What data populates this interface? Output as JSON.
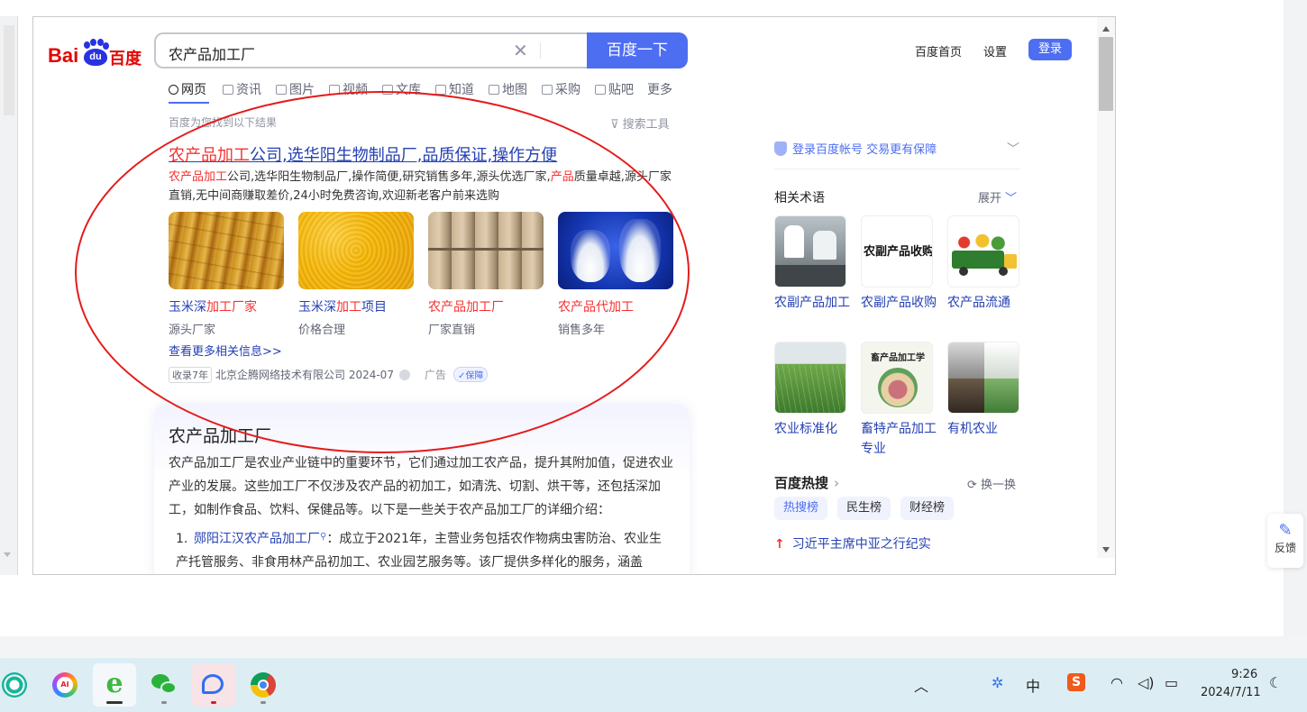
{
  "search": {
    "query": "农产品加工厂",
    "button_label": "百度一下"
  },
  "logo": {
    "bai": "Bai",
    "du": "du",
    "baidu_cn": "百度"
  },
  "header": {
    "home_link": "百度首页",
    "settings_link": "设置",
    "login_button": "登录"
  },
  "tabs": [
    {
      "label": "网页",
      "icon": "search-icon"
    },
    {
      "label": "资讯",
      "icon": "news-icon"
    },
    {
      "label": "图片",
      "icon": "image-icon"
    },
    {
      "label": "视频",
      "icon": "video-icon"
    },
    {
      "label": "文库",
      "icon": "doc-icon"
    },
    {
      "label": "知道",
      "icon": "question-icon"
    },
    {
      "label": "地图",
      "icon": "map-icon"
    },
    {
      "label": "采购",
      "icon": "purchase-icon"
    },
    {
      "label": "贴吧",
      "icon": "tieba-icon"
    },
    {
      "label": "更多",
      "icon": ""
    }
  ],
  "results_header": {
    "found_text": "百度为您找到以下结果",
    "tools_text": "搜索工具"
  },
  "ad_result": {
    "title_hl": "农产品加工",
    "title_rest": "公司,选华阳生物制品厂,品质保证,操作方便",
    "desc_1_hl": "农产品加工",
    "desc_1_mid": "公司,选华阳生物制品厂,操作简便,研究销售多年,源头优选厂家,",
    "desc_1_hl2": "产品",
    "desc_1_end": "质量卓越,源头厂家",
    "desc_2": "直销,无中间商赚取差价,24小时免费咨询,欢迎新老客户前来选购",
    "images": [
      {
        "label_a": "玉米深",
        "label_hl": "加工厂家",
        "label_c": "",
        "sub": "源头厂家"
      },
      {
        "label_a": "玉米深",
        "label_hl": "加工",
        "label_c": "项目",
        "sub": "价格合理"
      },
      {
        "label_a": "",
        "label_hl": "农产品加工厂",
        "label_c": "",
        "sub": "厂家直销"
      },
      {
        "label_a": "",
        "label_hl": "农产品代加工",
        "label_c": "",
        "sub": "销售多年"
      }
    ],
    "more_link": "查看更多相关信息>>",
    "badge": "收录7年",
    "company": "北京企腾网络技术有限公司 2024-07",
    "ad_label": "广告",
    "guarantee": "保障"
  },
  "ai_card": {
    "title": "农产品加工厂",
    "body": "农产品加工厂是农业产业链中的重要环节，它们通过加工农产品，提升其附加值，促进农业产业的发展。这些加工厂不仅涉及农产品的初加工，如清洗、切割、烘干等，还包括深加工，如制作食品、饮料、保健品等。以下是一些关于农产品加工厂的详细介绍：",
    "item_1_num": "1.",
    "item_1_link": "郧阳江汉农产品加工厂",
    "item_1_text": "：成立于2021年，主营业务包括农作物病虫害防治、农业生产托管服务、非食用林产品初加工、农业园艺服务等。该厂提供多样化的服务，涵盖"
  },
  "sidebar": {
    "login_tip": "登录百度帐号 交易更有保障",
    "related_title": "相关术语",
    "expand_label": "展开",
    "terms": [
      {
        "label": "农副产品加工"
      },
      {
        "label": "农副产品收购"
      },
      {
        "label": "农产品流通"
      },
      {
        "label": "农业标准化"
      },
      {
        "label": "畜特产品加工专业"
      },
      {
        "label": "有机农业"
      }
    ],
    "term_img_text_1": "农副产品收购",
    "term_img_text_2": "畜产品加工学",
    "hot_title": "百度热搜",
    "refresh_label": "换一换",
    "hot_tabs": [
      "热搜榜",
      "民生榜",
      "财经榜"
    ],
    "hot_item_1": "习近平主席中亚之行纪实"
  },
  "feedback_label": "反馈",
  "taskbar": {
    "apps": [
      "app-center-icon",
      "ai-assistant-icon",
      "ie-browser-icon",
      "wechat-icon",
      "chat-app-icon",
      "chrome-icon"
    ],
    "ime_label": "中",
    "time": "9:26",
    "date": "2024/7/11"
  }
}
